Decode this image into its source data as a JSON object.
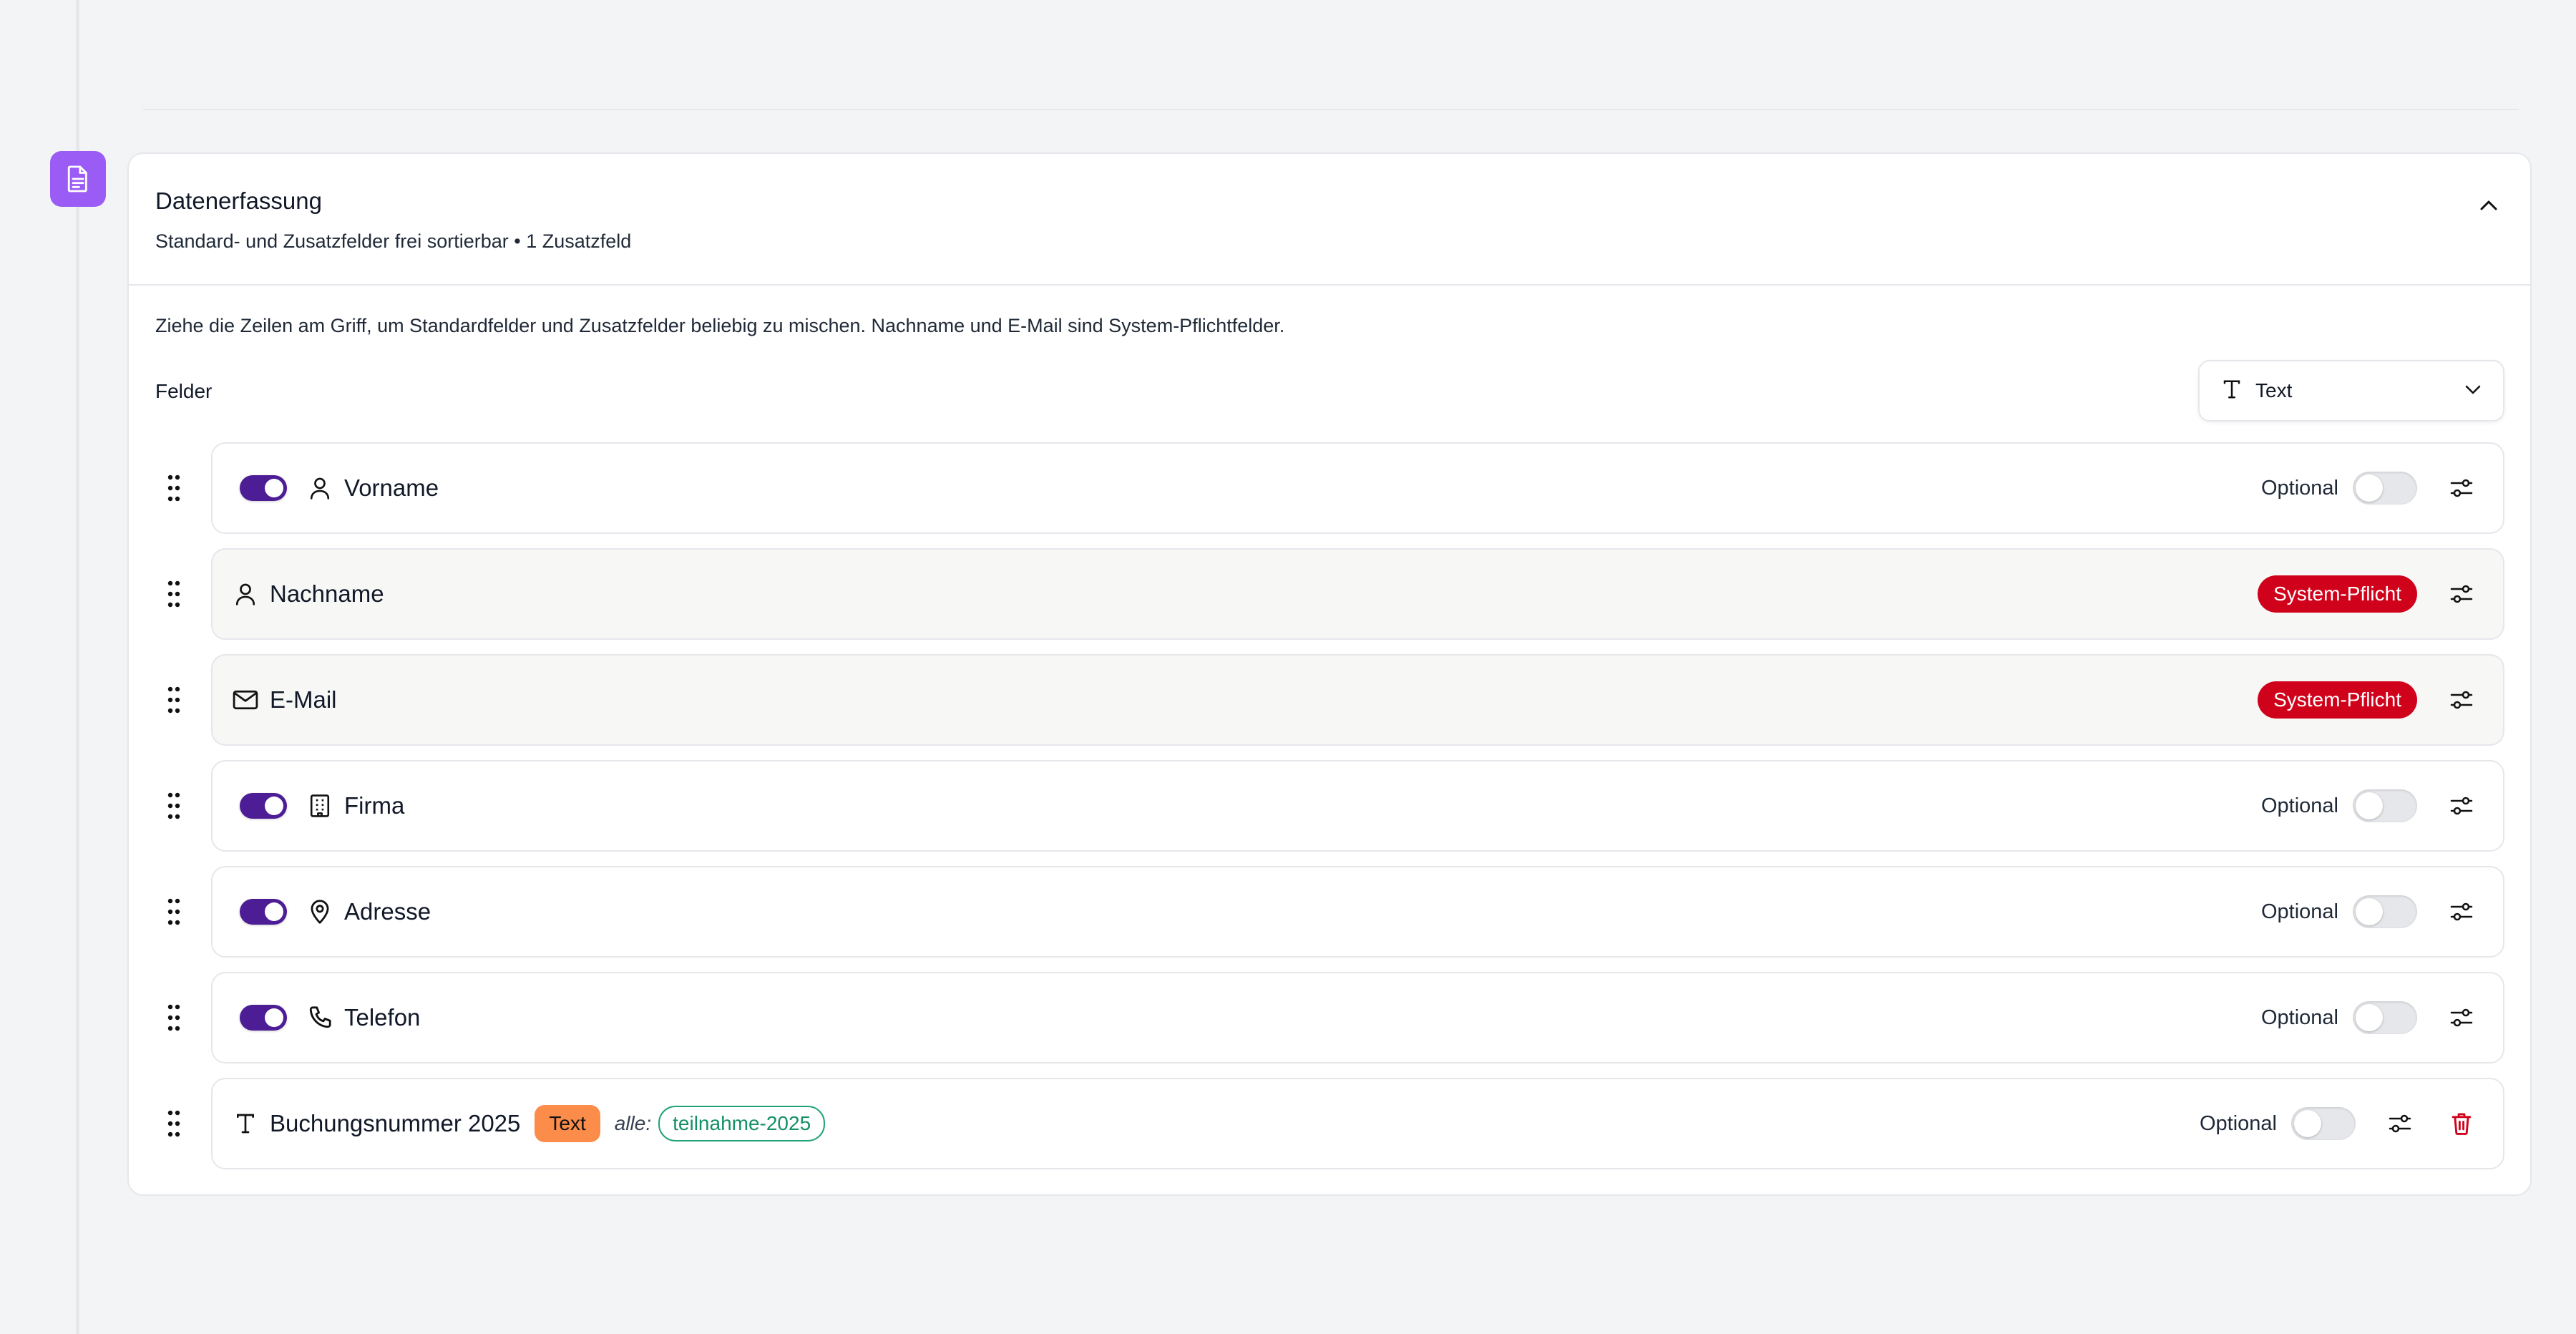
{
  "section": {
    "icon": "document-icon",
    "title": "Datenerfassung",
    "subtitle": "Standard- und Zusatzfelder frei sortierbar • 1 Zusatzfeld",
    "hint": "Ziehe die Zeilen am Griff, um Standardfelder und Zusatzfelder beliebig zu mischen. Nachname und E-Mail sind System-Pflichtfelder.",
    "fields_label": "Felder",
    "type_select": {
      "icon": "text-type-icon",
      "value": "Text"
    }
  },
  "colors": {
    "accent": "#9b5cf6",
    "toggle_on": "#4c1d95",
    "system_badge": "#d0021b",
    "text_badge": "#fb8c4a",
    "tag": "#149067",
    "delete": "#d0021b"
  },
  "fields": [
    {
      "name": "Vorname",
      "icon": "user-icon",
      "enabled": true,
      "optional_label": "Optional",
      "required": false
    },
    {
      "name": "Nachname",
      "icon": "user-icon",
      "system_badge": "System-Pflicht"
    },
    {
      "name": "E-Mail",
      "icon": "mail-icon",
      "system_badge": "System-Pflicht"
    },
    {
      "name": "Firma",
      "icon": "building-icon",
      "enabled": true,
      "optional_label": "Optional",
      "required": false
    },
    {
      "name": "Adresse",
      "icon": "map-pin-icon",
      "enabled": true,
      "optional_label": "Optional",
      "required": false
    },
    {
      "name": "Telefon",
      "icon": "phone-icon",
      "enabled": true,
      "optional_label": "Optional",
      "required": false
    },
    {
      "name": "Buchungsnummer 2025",
      "icon": "text-type-icon",
      "type_badge": "Text",
      "scope_label": "alle:",
      "tag": "teilnahme-2025",
      "optional_label": "Optional",
      "required": false
    }
  ]
}
